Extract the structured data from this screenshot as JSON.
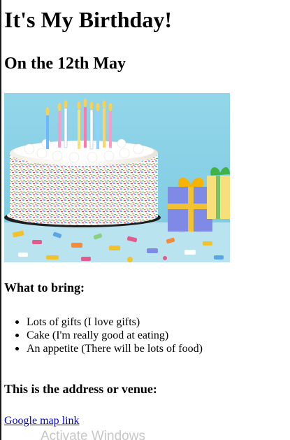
{
  "page": {
    "title": "It's My Birthday!",
    "date_heading": "On the 12th May",
    "bring_heading": "What to bring:",
    "bring_items": [
      "Lots of gifts (I love gifts)",
      "Cake (I'm really good at eating)",
      "An appetite (There will be lots of food)"
    ],
    "venue_heading": "This is the address or venue:",
    "map_link": "Google map link"
  },
  "overlay": {
    "watermark": "Activate Windows"
  },
  "colors": {
    "link": "#0000ee",
    "background": "#ffffff",
    "text": "#000000",
    "photo_bg": "#8fd3e8"
  },
  "image": {
    "subject": "birthday-cake-with-candles-and-gifts"
  }
}
